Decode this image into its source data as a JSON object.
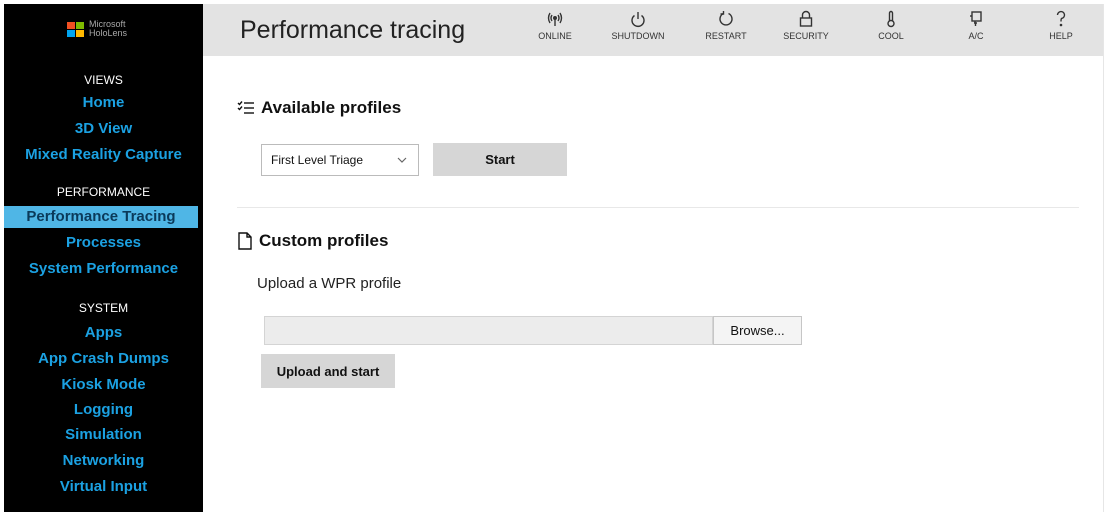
{
  "brand": {
    "line1": "Microsoft",
    "line2": "HoloLens",
    "logo_colors": [
      "#f25022",
      "#7fba00",
      "#00a4ef",
      "#ffb900"
    ]
  },
  "sidebar": {
    "sections": [
      {
        "title": "VIEWS",
        "items": [
          {
            "label": "Home",
            "active": false
          },
          {
            "label": "3D View",
            "active": false
          },
          {
            "label": "Mixed Reality Capture",
            "active": false
          }
        ]
      },
      {
        "title": "PERFORMANCE",
        "items": [
          {
            "label": "Performance Tracing",
            "active": true
          },
          {
            "label": "Processes",
            "active": false
          },
          {
            "label": "System Performance",
            "active": false
          }
        ]
      },
      {
        "title": "SYSTEM",
        "items": [
          {
            "label": "Apps",
            "active": false
          },
          {
            "label": "App Crash Dumps",
            "active": false
          },
          {
            "label": "Kiosk Mode",
            "active": false
          },
          {
            "label": "Logging",
            "active": false
          },
          {
            "label": "Simulation",
            "active": false
          },
          {
            "label": "Networking",
            "active": false
          },
          {
            "label": "Virtual Input",
            "active": false
          }
        ]
      }
    ]
  },
  "header": {
    "title": "Performance tracing",
    "buttons": [
      {
        "label": "ONLINE",
        "icon": "online-icon"
      },
      {
        "label": "SHUTDOWN",
        "icon": "power-icon"
      },
      {
        "label": "RESTART",
        "icon": "restart-icon"
      },
      {
        "label": "SECURITY",
        "icon": "lock-icon"
      },
      {
        "label": "COOL",
        "icon": "thermometer-icon"
      },
      {
        "label": "A/C",
        "icon": "plug-icon"
      },
      {
        "label": "HELP",
        "icon": "help-icon"
      }
    ]
  },
  "available_profiles": {
    "heading": "Available profiles",
    "icon": "checklist-icon",
    "selected_profile": "First Level Triage",
    "start_label": "Start"
  },
  "custom_profiles": {
    "heading": "Custom profiles",
    "icon": "document-icon",
    "upload_label": "Upload a WPR profile",
    "file_value": "",
    "browse_label": "Browse...",
    "upload_start_label": "Upload and start"
  },
  "colors": {
    "sidebar_bg": "#000000",
    "nav_link": "#1ba1e2",
    "nav_active_bg": "#4fb6e6",
    "header_bg": "#e3e3e3",
    "button_bg": "#d6d6d6"
  }
}
